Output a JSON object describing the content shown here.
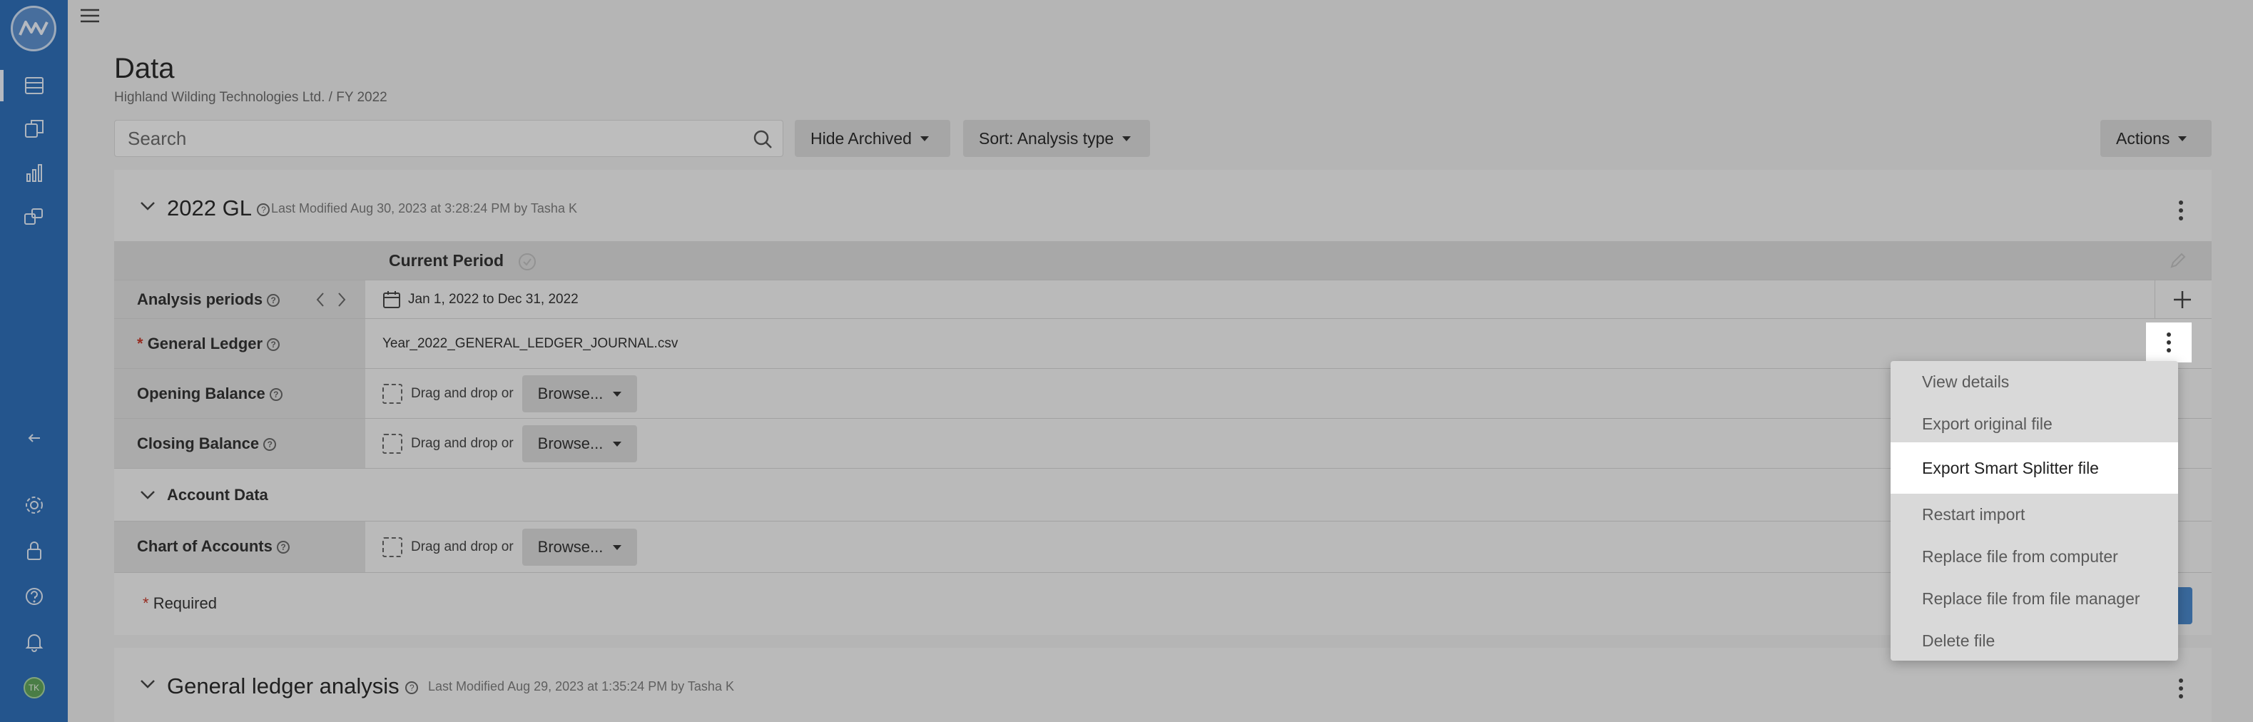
{
  "sidebar": {
    "items": [
      {
        "icon": "database-icon"
      },
      {
        "icon": "copy-icon"
      },
      {
        "icon": "bar-chart-icon"
      },
      {
        "icon": "transfer-icon"
      },
      {
        "icon": "collapse-arrow-icon"
      },
      {
        "icon": "gear-icon"
      },
      {
        "icon": "lock-icon"
      },
      {
        "icon": "help-icon"
      },
      {
        "icon": "bell-icon"
      }
    ],
    "avatar_initials": "TK"
  },
  "header": {
    "title": "Data",
    "breadcrumb": "Highland Wilding Technologies Ltd. / FY 2022"
  },
  "toolbar": {
    "search_placeholder": "Search",
    "hide_archived_label": "Hide Archived",
    "sort_label": "Sort: Analysis type",
    "actions_label": "Actions"
  },
  "card": {
    "title": "2022 GL",
    "meta": "Last Modified Aug 30, 2023 at 3:28:24 PM by Tasha K",
    "period_header": "Current Period",
    "rows": {
      "analysis_periods": {
        "label": "Analysis periods",
        "value": "Jan 1, 2022 to Dec 31, 2022"
      },
      "general_ledger": {
        "required_mark": "*",
        "label": "General Ledger",
        "value": "Year_2022_GENERAL_LEDGER_JOURNAL.csv"
      },
      "opening_balance": {
        "label": "Opening Balance",
        "drop_text": "Drag and drop or",
        "browse_label": "Browse..."
      },
      "closing_balance": {
        "label": "Closing Balance",
        "drop_text": "Drag and drop or",
        "browse_label": "Browse..."
      },
      "account_data": {
        "label": "Account Data"
      },
      "chart_of_accounts": {
        "label": "Chart of Accounts",
        "drop_text": "Drag and drop or",
        "browse_label": "Browse..."
      }
    },
    "required_note": {
      "mark": "*",
      "text": "Required"
    }
  },
  "card2": {
    "title": "General ledger analysis",
    "meta": "Last Modified Aug 29, 2023 at 1:35:24 PM by Tasha K"
  },
  "file_menu": {
    "items": [
      "View details",
      "Export original file",
      "Export Smart Splitter file",
      "Restart import",
      "Replace file from computer",
      "Replace file from file manager",
      "Delete file"
    ],
    "highlighted_index": 2
  },
  "colors": {
    "sidebar": "#2f6db5",
    "accent": "#4a86c7",
    "required": "#c0392b"
  }
}
